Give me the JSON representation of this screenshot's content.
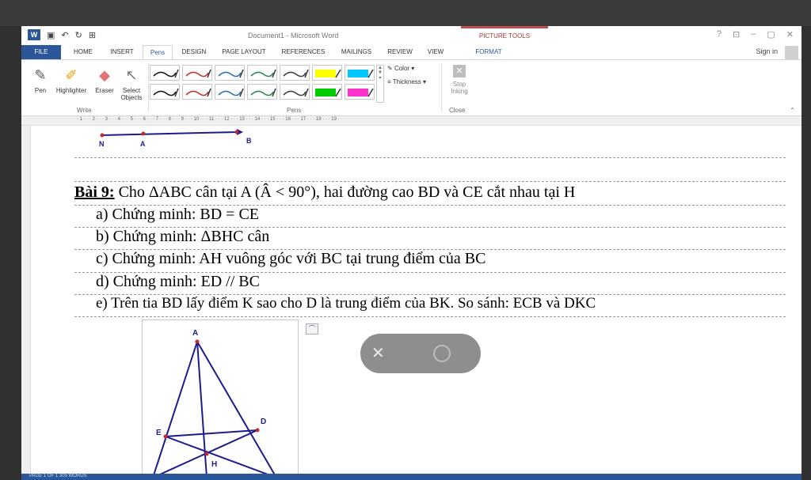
{
  "titlebar": {
    "app_icon": "W",
    "title": "Document1 - Microsoft Word",
    "contextual_group": "PICTURE TOOLS",
    "controls": [
      "?",
      "⊡",
      "–",
      "▢",
      "✕"
    ]
  },
  "tabs": [
    {
      "label": "FILE"
    },
    {
      "label": "HOME"
    },
    {
      "label": "INSERT"
    },
    {
      "label": "Pens"
    },
    {
      "label": "DESIGN"
    },
    {
      "label": "PAGE LAYOUT"
    },
    {
      "label": "REFERENCES"
    },
    {
      "label": "MAILINGS"
    },
    {
      "label": "REVIEW"
    },
    {
      "label": "VIEW"
    },
    {
      "label": "FORMAT"
    }
  ],
  "active_tab": "Pens",
  "signin": "Sign in",
  "ribbon": {
    "write_group": {
      "label": "Write",
      "tools": [
        {
          "label": "Pen",
          "icon": "pen-icon"
        },
        {
          "label": "Highlighter",
          "icon": "highlighter-icon"
        },
        {
          "label": "Eraser",
          "icon": "eraser-icon"
        },
        {
          "label": "Select Objects",
          "icon": "select-objects-icon"
        }
      ]
    },
    "pens_group": {
      "label": "Pens",
      "swatches": [
        "#1a1a1a",
        "#c0392b",
        "#2e75b6",
        "#2e8b57",
        "#444444",
        "#ffff00",
        "#00c8ff",
        "#1a1a1a",
        "#c0392b",
        "#2e75b6",
        "#2e8b57",
        "#444444",
        "#00cc00",
        "#ff33cc"
      ],
      "color_label": "Color",
      "thickness_label": "Thickness"
    },
    "close_group": {
      "label": "Close",
      "stop_label": "Stop Inking"
    }
  },
  "ruler": "· 1 · · · 2 · · · 3 · · · 4 · · · 5 · · · 6 · · · 7 · · · 8 · · · 9 · · · 10 · · · 11 · · · 12 · · · 13 · · · 14 · · · 15 · · · 16 · · · 17 · · · 18 · · · 19 ·",
  "document": {
    "figure_top_labels": [
      "N",
      "A",
      "B"
    ],
    "lines": [
      {
        "label": "Bài 9:",
        "text": " Cho ΔABC cân tại A (Â < 90°), hai đường cao BD và CE cắt nhau tại H"
      },
      {
        "text": "a) Chứng minh: BD = CE"
      },
      {
        "text": "b) Chứng minh:  ΔBHC cân"
      },
      {
        "text": "c) Chứng minh: AH vuông góc với BC tại trung điểm của BC"
      },
      {
        "text": "d) Chứng minh: ED // BC"
      },
      {
        "text": "e) Trên tia BD lấy điểm K sao cho D là trung điểm của BK. So sánh: ECB và DKC"
      }
    ],
    "figure_bottom_labels": [
      "A",
      "E",
      "D",
      "H"
    ]
  },
  "status": "PAGE 1 OF 1    305 WORDS"
}
